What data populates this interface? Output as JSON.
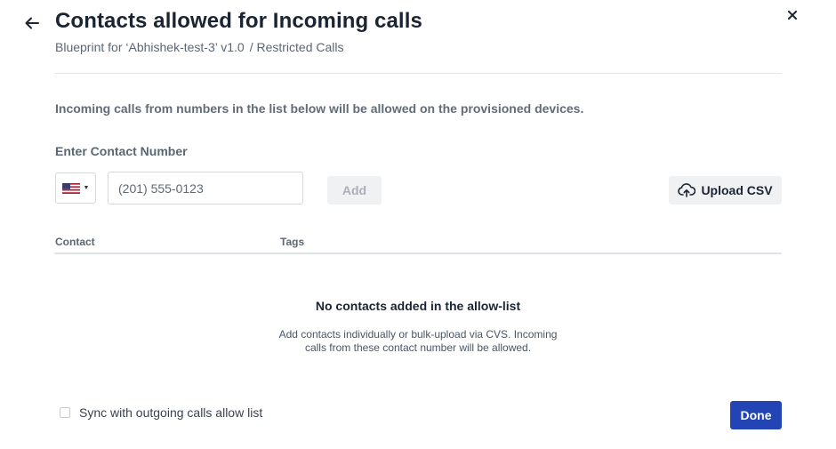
{
  "header": {
    "title": "Contacts allowed for Incoming calls",
    "subtitle_blueprint": "Blueprint for ‘Abhishek-test-3’ v1.0",
    "subtitle_section": "/ Restricted Calls",
    "back_icon": "arrow-left-icon",
    "close_icon": "close-icon"
  },
  "description": "Incoming calls from numbers in the list below will be allowed on the provisioned devices.",
  "form": {
    "field_label": "Enter Contact Number",
    "country_flag_icon": "us-flag-icon",
    "phone_placeholder": "(201) 555-0123",
    "add_label": "Add",
    "upload_label": "Upload CSV",
    "upload_icon": "cloud-upload-icon"
  },
  "table": {
    "columns": [
      "Contact",
      "Tags"
    ]
  },
  "empty_state": {
    "title": "No contacts added in the allow-list",
    "description": "Add contacts individually or bulk-upload via CVS. Incoming calls from these contact number will be allowed."
  },
  "footer": {
    "sync_label": "Sync with outgoing calls allow list",
    "sync_checked": false,
    "done_label": "Done"
  },
  "colors": {
    "primary": "#2344b5",
    "title_text": "#1b2433",
    "muted_text": "#5b6675",
    "button_disabled_bg": "#eff1f3"
  }
}
